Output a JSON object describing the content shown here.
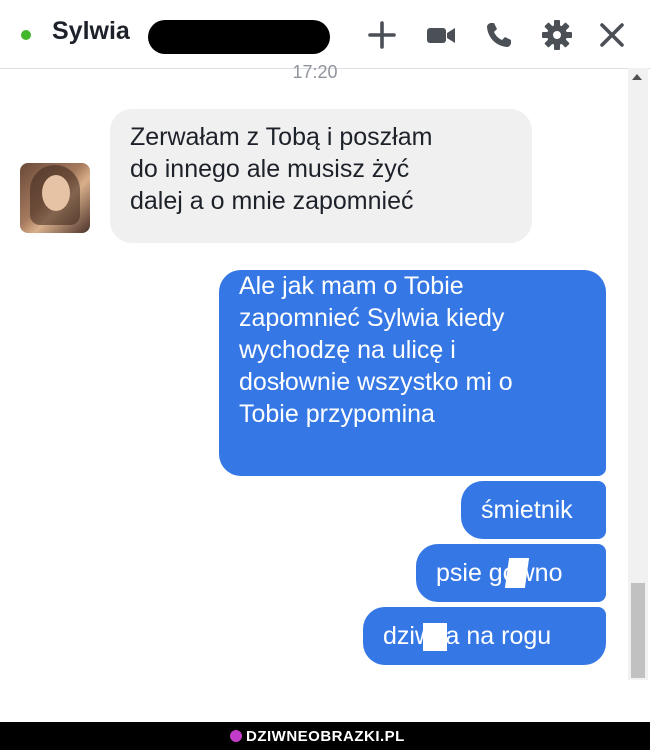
{
  "header": {
    "contact_name": "Sylwia",
    "online_color": "#42b72a",
    "icons": [
      "plus-icon",
      "video-camera-icon",
      "phone-icon",
      "gear-icon",
      "close-icon"
    ]
  },
  "conversation": {
    "timestamp": "17:20",
    "messages": [
      {
        "sender": "contact",
        "lines": [
          "Zerwałam z Tobą i poszłam",
          "do innego ale musisz żyć",
          "dalej a o mnie zapomnieć"
        ]
      },
      {
        "sender": "me",
        "lines": [
          "Ale jak mam o Tobie",
          "zapomnieć Sylwia kiedy",
          "wychodzę na ulicę i",
          "dosłownie wszystko mi o",
          "Tobie przypomina"
        ]
      },
      {
        "sender": "me",
        "text": "śmietnik"
      },
      {
        "sender": "me",
        "text": "psie gówno"
      },
      {
        "sender": "me",
        "text": "dziwka na rogu"
      }
    ]
  },
  "colors": {
    "outgoing_bubble": "#3578e5",
    "incoming_bubble": "#f1f0f0"
  },
  "watermark": {
    "text": "DZIWNEOBRAZKI.PL"
  }
}
